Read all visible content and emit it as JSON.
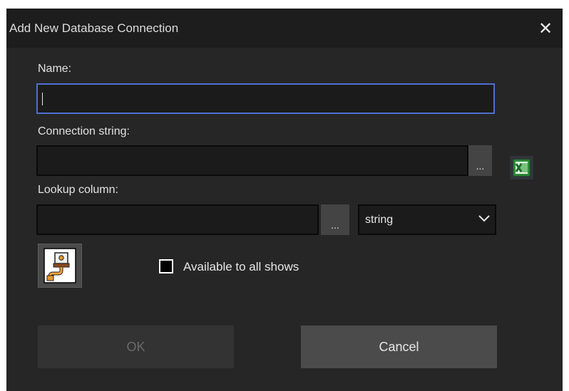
{
  "dialog": {
    "title": "Add New Database Connection",
    "close_glyph": "✕"
  },
  "name": {
    "label": "Name:",
    "value": ""
  },
  "connection": {
    "label": "Connection string:",
    "value": "",
    "browse_label": "..."
  },
  "lookup": {
    "label": "Lookup column:",
    "value": "",
    "browse_label": "...",
    "type_selected": "string"
  },
  "shared": {
    "label": "Available to all shows",
    "checked": false
  },
  "buttons": {
    "ok": "OK",
    "cancel": "Cancel",
    "ok_enabled": false
  },
  "colors": {
    "accent_focus": "#4e6fd0",
    "background": "#262626",
    "titlebar": "#1d1d1d"
  },
  "icons": {
    "excel": "excel-icon",
    "connection": "database-connection-icon",
    "chevron": "chevron-down-icon"
  }
}
